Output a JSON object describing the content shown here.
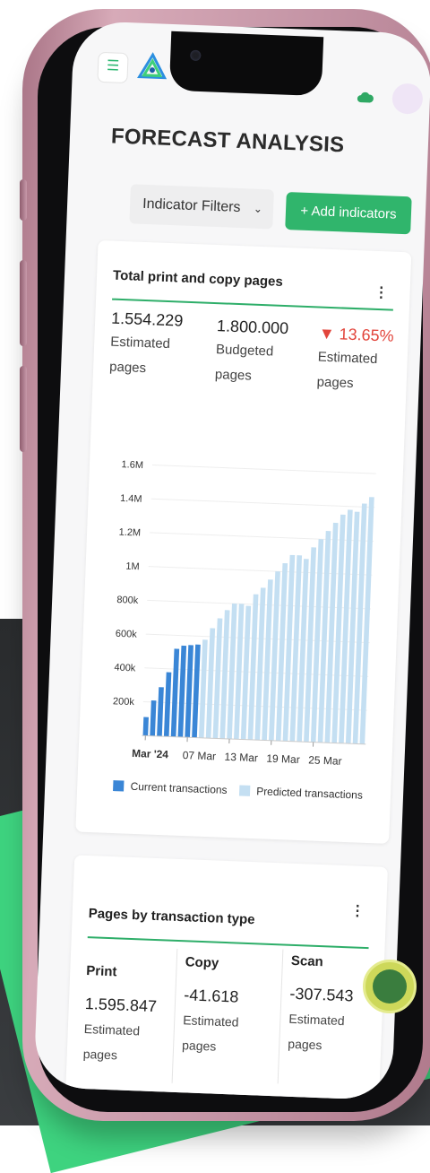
{
  "page": {
    "title": "FORECAST ANALYSIS",
    "filter_button": "Indicator Filters",
    "add_button": "Add indicators"
  },
  "colors": {
    "accent_green": "#30b56c",
    "negative_red": "#e2453c",
    "current_bar": "#3a86d6",
    "predicted_bar": "#c4dff2",
    "phone_pink": "#c393a4"
  },
  "icons": {
    "menu": "hamburger-icon",
    "add": "plus-icon",
    "filter": "chevron-down-icon",
    "more": "kebab-menu-icon",
    "support": "headset-agent-icon"
  },
  "card_print_copy": {
    "title": "Total print and copy pages",
    "metrics": [
      {
        "value": "1.554.229",
        "label_1": "Estimated",
        "label_2": "pages"
      },
      {
        "value": "1.800.000",
        "label_1": "Budgeted",
        "label_2": "pages"
      },
      {
        "value": "13.65%",
        "label_1": "Estimated",
        "label_2": "pages",
        "trend": "down"
      }
    ]
  },
  "chart_data": {
    "type": "bar",
    "title": "",
    "xlabel": "",
    "ylabel": "",
    "ylim": [
      0,
      1600000
    ],
    "y_ticks": [
      "200k",
      "400k",
      "600k",
      "800k",
      "1M",
      "1.2M",
      "1.4M",
      "1.6M"
    ],
    "x_ticks": [
      "Mar '24",
      "07 Mar",
      "13 Mar",
      "19 Mar",
      "25 Mar"
    ],
    "series": [
      {
        "name": "Current transactions",
        "values": [
          110000,
          210000,
          290000,
          380000,
          520000,
          540000,
          545000,
          550000,
          0,
          0,
          0,
          0,
          0,
          0,
          0,
          0,
          0,
          0,
          0,
          0,
          0,
          0,
          0,
          0,
          0,
          0,
          0,
          0,
          0,
          0,
          0,
          0
        ]
      },
      {
        "name": "Predicted transactions",
        "values": [
          0,
          0,
          0,
          0,
          0,
          0,
          0,
          0,
          580000,
          650000,
          710000,
          760000,
          800000,
          800000,
          790000,
          860000,
          900000,
          950000,
          1000000,
          1050000,
          1100000,
          1100000,
          1080000,
          1150000,
          1200000,
          1250000,
          1300000,
          1350000,
          1380000,
          1370000,
          1420000,
          1460000
        ]
      }
    ],
    "legend": "bottom",
    "grid": true
  },
  "card_transaction": {
    "title": "Pages by transaction type",
    "columns": [
      {
        "head": "Print",
        "value": "1.595.847",
        "label_1": "Estimated",
        "label_2": "pages"
      },
      {
        "head": "Copy",
        "value": "-41.618",
        "label_1": "Estimated",
        "label_2": "pages"
      },
      {
        "head": "Scan",
        "value": "-307.543",
        "label_1": "Estimated",
        "label_2": "pages"
      }
    ]
  }
}
